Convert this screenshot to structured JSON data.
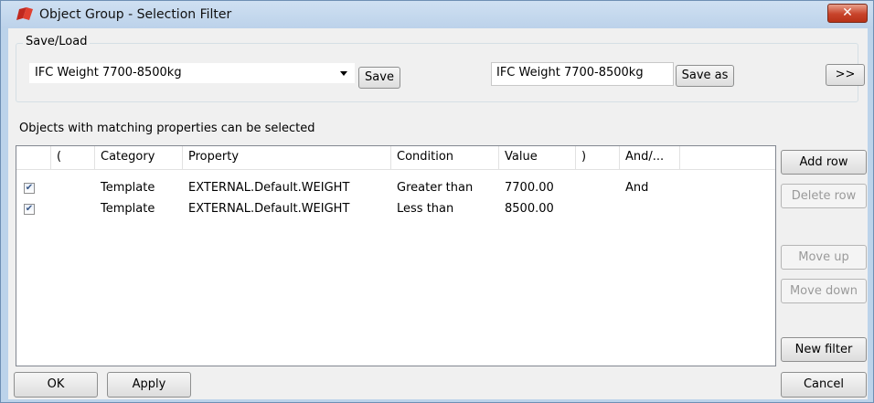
{
  "window": {
    "title": "Object Group - Selection Filter",
    "close_label": "✕"
  },
  "save_load": {
    "group_label": "Save/Load",
    "selected_filter": "IFC Weight 7700-8500kg",
    "save_label": "Save",
    "save_as_name": "IFC Weight 7700-8500kg",
    "save_as_label": "Save as",
    "expand_label": ">>"
  },
  "hint": "Objects with matching properties can be selected",
  "table": {
    "columns": [
      "",
      "(",
      "Category",
      "Property",
      "Condition",
      "Value",
      ")",
      "And/..."
    ],
    "rows": [
      {
        "checked": true,
        "open_paren": "",
        "category": "Template",
        "property": "EXTERNAL.Default.WEIGHT",
        "condition": "Greater than",
        "value": "7700.00",
        "close_paren": "",
        "and_or": "And"
      },
      {
        "checked": true,
        "open_paren": "",
        "category": "Template",
        "property": "EXTERNAL.Default.WEIGHT",
        "condition": "Less than",
        "value": "8500.00",
        "close_paren": "",
        "and_or": ""
      }
    ]
  },
  "side_buttons": {
    "add_row": "Add row",
    "delete_row": "Delete row",
    "move_up": "Move up",
    "move_down": "Move down",
    "new_filter": "New filter"
  },
  "footer": {
    "ok": "OK",
    "apply": "Apply",
    "cancel": "Cancel"
  },
  "colors": {
    "titlebar": "#bcd2ea",
    "client_bg": "#f0f0f0",
    "close_button": "#c8432a",
    "app_icon_red": "#c0281e"
  },
  "icons": {
    "app": "app-logo-icon",
    "close": "close-icon",
    "dropdown": "chevron-down-icon",
    "checkbox": "checkbox-checked-icon"
  }
}
